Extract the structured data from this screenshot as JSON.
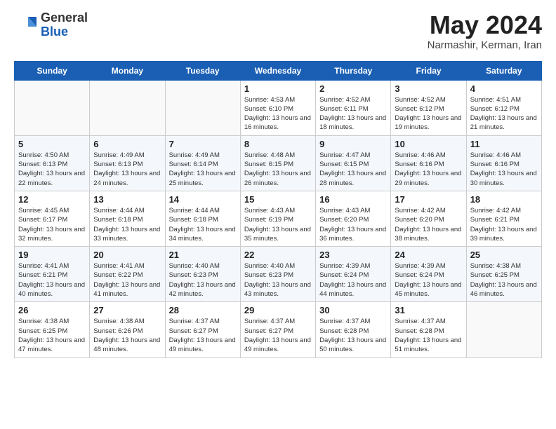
{
  "logo": {
    "general": "General",
    "blue": "Blue"
  },
  "title": {
    "month_year": "May 2024",
    "location": "Narmashir, Kerman, Iran"
  },
  "weekdays": [
    "Sunday",
    "Monday",
    "Tuesday",
    "Wednesday",
    "Thursday",
    "Friday",
    "Saturday"
  ],
  "weeks": [
    [
      {
        "day": "",
        "sunrise": "",
        "sunset": "",
        "daylight": ""
      },
      {
        "day": "",
        "sunrise": "",
        "sunset": "",
        "daylight": ""
      },
      {
        "day": "",
        "sunrise": "",
        "sunset": "",
        "daylight": ""
      },
      {
        "day": "1",
        "sunrise": "Sunrise: 4:53 AM",
        "sunset": "Sunset: 6:10 PM",
        "daylight": "Daylight: 13 hours and 16 minutes."
      },
      {
        "day": "2",
        "sunrise": "Sunrise: 4:52 AM",
        "sunset": "Sunset: 6:11 PM",
        "daylight": "Daylight: 13 hours and 18 minutes."
      },
      {
        "day": "3",
        "sunrise": "Sunrise: 4:52 AM",
        "sunset": "Sunset: 6:12 PM",
        "daylight": "Daylight: 13 hours and 19 minutes."
      },
      {
        "day": "4",
        "sunrise": "Sunrise: 4:51 AM",
        "sunset": "Sunset: 6:12 PM",
        "daylight": "Daylight: 13 hours and 21 minutes."
      }
    ],
    [
      {
        "day": "5",
        "sunrise": "Sunrise: 4:50 AM",
        "sunset": "Sunset: 6:13 PM",
        "daylight": "Daylight: 13 hours and 22 minutes."
      },
      {
        "day": "6",
        "sunrise": "Sunrise: 4:49 AM",
        "sunset": "Sunset: 6:13 PM",
        "daylight": "Daylight: 13 hours and 24 minutes."
      },
      {
        "day": "7",
        "sunrise": "Sunrise: 4:49 AM",
        "sunset": "Sunset: 6:14 PM",
        "daylight": "Daylight: 13 hours and 25 minutes."
      },
      {
        "day": "8",
        "sunrise": "Sunrise: 4:48 AM",
        "sunset": "Sunset: 6:15 PM",
        "daylight": "Daylight: 13 hours and 26 minutes."
      },
      {
        "day": "9",
        "sunrise": "Sunrise: 4:47 AM",
        "sunset": "Sunset: 6:15 PM",
        "daylight": "Daylight: 13 hours and 28 minutes."
      },
      {
        "day": "10",
        "sunrise": "Sunrise: 4:46 AM",
        "sunset": "Sunset: 6:16 PM",
        "daylight": "Daylight: 13 hours and 29 minutes."
      },
      {
        "day": "11",
        "sunrise": "Sunrise: 4:46 AM",
        "sunset": "Sunset: 6:16 PM",
        "daylight": "Daylight: 13 hours and 30 minutes."
      }
    ],
    [
      {
        "day": "12",
        "sunrise": "Sunrise: 4:45 AM",
        "sunset": "Sunset: 6:17 PM",
        "daylight": "Daylight: 13 hours and 32 minutes."
      },
      {
        "day": "13",
        "sunrise": "Sunrise: 4:44 AM",
        "sunset": "Sunset: 6:18 PM",
        "daylight": "Daylight: 13 hours and 33 minutes."
      },
      {
        "day": "14",
        "sunrise": "Sunrise: 4:44 AM",
        "sunset": "Sunset: 6:18 PM",
        "daylight": "Daylight: 13 hours and 34 minutes."
      },
      {
        "day": "15",
        "sunrise": "Sunrise: 4:43 AM",
        "sunset": "Sunset: 6:19 PM",
        "daylight": "Daylight: 13 hours and 35 minutes."
      },
      {
        "day": "16",
        "sunrise": "Sunrise: 4:43 AM",
        "sunset": "Sunset: 6:20 PM",
        "daylight": "Daylight: 13 hours and 36 minutes."
      },
      {
        "day": "17",
        "sunrise": "Sunrise: 4:42 AM",
        "sunset": "Sunset: 6:20 PM",
        "daylight": "Daylight: 13 hours and 38 minutes."
      },
      {
        "day": "18",
        "sunrise": "Sunrise: 4:42 AM",
        "sunset": "Sunset: 6:21 PM",
        "daylight": "Daylight: 13 hours and 39 minutes."
      }
    ],
    [
      {
        "day": "19",
        "sunrise": "Sunrise: 4:41 AM",
        "sunset": "Sunset: 6:21 PM",
        "daylight": "Daylight: 13 hours and 40 minutes."
      },
      {
        "day": "20",
        "sunrise": "Sunrise: 4:41 AM",
        "sunset": "Sunset: 6:22 PM",
        "daylight": "Daylight: 13 hours and 41 minutes."
      },
      {
        "day": "21",
        "sunrise": "Sunrise: 4:40 AM",
        "sunset": "Sunset: 6:23 PM",
        "daylight": "Daylight: 13 hours and 42 minutes."
      },
      {
        "day": "22",
        "sunrise": "Sunrise: 4:40 AM",
        "sunset": "Sunset: 6:23 PM",
        "daylight": "Daylight: 13 hours and 43 minutes."
      },
      {
        "day": "23",
        "sunrise": "Sunrise: 4:39 AM",
        "sunset": "Sunset: 6:24 PM",
        "daylight": "Daylight: 13 hours and 44 minutes."
      },
      {
        "day": "24",
        "sunrise": "Sunrise: 4:39 AM",
        "sunset": "Sunset: 6:24 PM",
        "daylight": "Daylight: 13 hours and 45 minutes."
      },
      {
        "day": "25",
        "sunrise": "Sunrise: 4:38 AM",
        "sunset": "Sunset: 6:25 PM",
        "daylight": "Daylight: 13 hours and 46 minutes."
      }
    ],
    [
      {
        "day": "26",
        "sunrise": "Sunrise: 4:38 AM",
        "sunset": "Sunset: 6:25 PM",
        "daylight": "Daylight: 13 hours and 47 minutes."
      },
      {
        "day": "27",
        "sunrise": "Sunrise: 4:38 AM",
        "sunset": "Sunset: 6:26 PM",
        "daylight": "Daylight: 13 hours and 48 minutes."
      },
      {
        "day": "28",
        "sunrise": "Sunrise: 4:37 AM",
        "sunset": "Sunset: 6:27 PM",
        "daylight": "Daylight: 13 hours and 49 minutes."
      },
      {
        "day": "29",
        "sunrise": "Sunrise: 4:37 AM",
        "sunset": "Sunset: 6:27 PM",
        "daylight": "Daylight: 13 hours and 49 minutes."
      },
      {
        "day": "30",
        "sunrise": "Sunrise: 4:37 AM",
        "sunset": "Sunset: 6:28 PM",
        "daylight": "Daylight: 13 hours and 50 minutes."
      },
      {
        "day": "31",
        "sunrise": "Sunrise: 4:37 AM",
        "sunset": "Sunset: 6:28 PM",
        "daylight": "Daylight: 13 hours and 51 minutes."
      },
      {
        "day": "",
        "sunrise": "",
        "sunset": "",
        "daylight": ""
      }
    ]
  ]
}
